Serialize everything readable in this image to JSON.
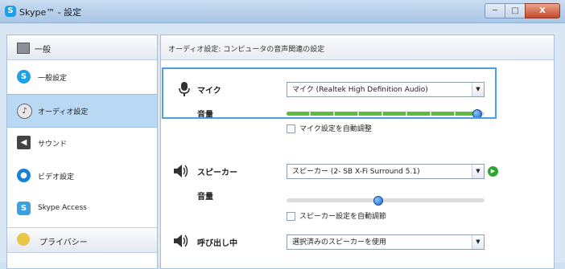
{
  "window": {
    "title": "Skype™ - 設定",
    "minimize": "─",
    "maximize": "□",
    "close": "X"
  },
  "sidebar": {
    "header_general": "一般",
    "items": [
      {
        "label": "一般設定",
        "icon": "skype-icon"
      },
      {
        "label": "オーディオ設定",
        "icon": "audio-icon",
        "selected": true
      },
      {
        "label": "サウンド",
        "icon": "sound-icon"
      },
      {
        "label": "ビデオ設定",
        "icon": "video-icon"
      },
      {
        "label": "Skype Access",
        "icon": "skype-access-icon"
      }
    ],
    "header_privacy": "プライバシー"
  },
  "panel": {
    "header": "オーディオ設定: コンピュータの音声関連の設定",
    "mic": {
      "label": "マイク",
      "device": "マイク (Realtek High Definition Audio)",
      "volume_label": "音量",
      "volume_level": 0.96,
      "auto_adjust_label": "マイク設定を自動調整",
      "auto_adjust_checked": false
    },
    "speaker": {
      "label": "スピーカー",
      "device": "スピーカー (2- SB X-Fi Surround 5.1)",
      "volume_label": "音量",
      "volume_level": 0.46,
      "auto_adjust_label": "スピーカー設定を自動調節",
      "auto_adjust_checked": false
    },
    "ringing": {
      "label": "呼び出し中",
      "device": "選択済みのスピーカーを使用"
    }
  },
  "colors": {
    "accent": "#4a9fe6",
    "selected_bg": "#b9d8f4",
    "slider_green": "#5bbd3d",
    "play_green": "#2fa52f"
  }
}
